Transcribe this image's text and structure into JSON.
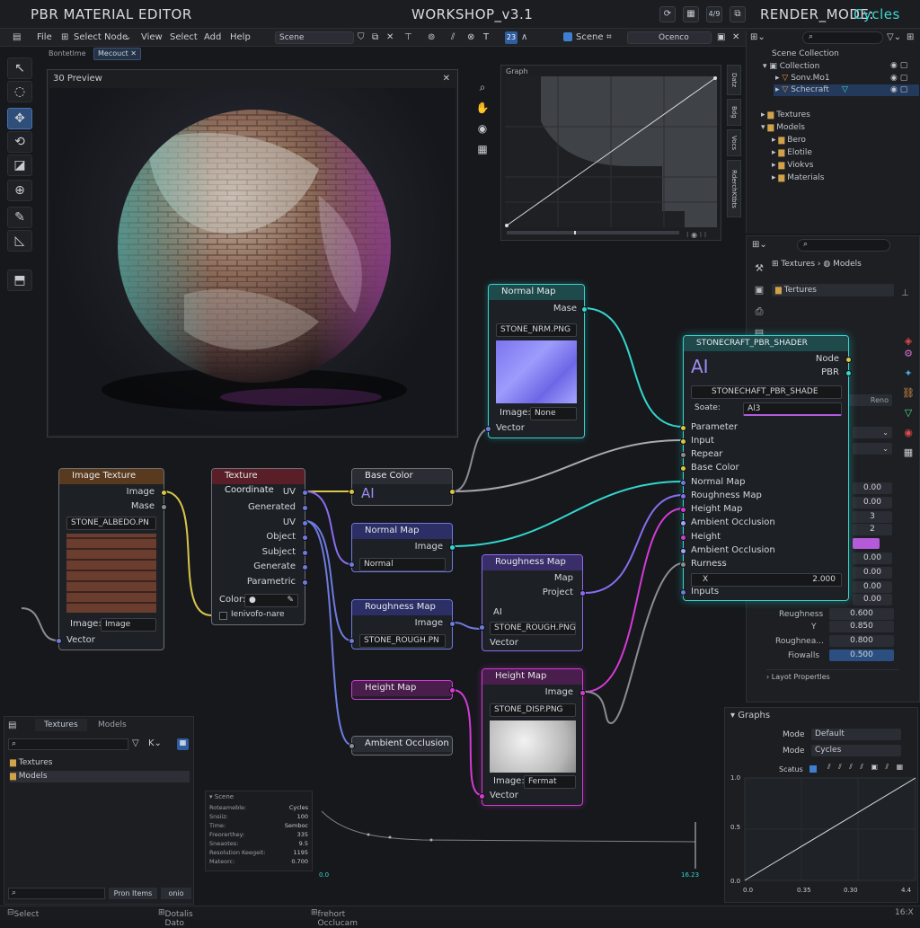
{
  "titlebar": {
    "app_title": "PBR MATERIAL EDITOR",
    "file_title": "WORKSHOP_v3.1",
    "render_mode_label": "RENDER_MODE:",
    "render_mode_value": "Cycles",
    "icons": [
      "refresh-icon",
      "grid-icon",
      "4/9",
      "copy-icon"
    ]
  },
  "menubar": {
    "items": [
      "File",
      "Select Node",
      "View",
      "Select",
      "Add",
      "Help"
    ],
    "scene_dropdown": "Scene",
    "tool_23": "23",
    "scene_label": "Scene",
    "scene_name": "Ocenco"
  },
  "tabs": {
    "first": "Bontetlme",
    "second": "Mecouct"
  },
  "preview": {
    "title": "30 Preview"
  },
  "graph": {
    "title": "Graph",
    "side_tabs": [
      "Datz",
      "Bdg",
      "Vocs",
      "RderchKtbts"
    ]
  },
  "outliner": {
    "items": [
      "Scene Collection",
      "Collection",
      "Sonv.Mo1",
      "Schecraft",
      "Textures",
      "Models",
      "Bero",
      "Elotile",
      "Viokvs",
      "Materials"
    ]
  },
  "props": {
    "breadcrumb_a": "Textures",
    "breadcrumb_b": "Models",
    "textures_field": "Tertures",
    "reno": "Reno",
    "values": [
      "0.00",
      "0.00",
      "3",
      "2",
      "0.00",
      "0.00",
      "0.00",
      "0.00"
    ],
    "roughness_label": "Reughness",
    "roughness_val": "0.600",
    "y_label": "Y",
    "y_val": "0.850",
    "roughnea_label": "Roughnea...",
    "roughnea_val": "0.800",
    "fiowalls_label": "Fiowalls",
    "fiowalls_val": "0.500",
    "layout_props": "Layot Propertles"
  },
  "nodes": {
    "normal_map_top": {
      "title": "Normal Map",
      "out": "Mase",
      "file": "STONE_NRM.PNG",
      "image_label": "Image:",
      "image_val": "None",
      "vector": "Vector"
    },
    "shader": {
      "title": "STONECRAFT_PBR_SHADER",
      "ai": "AI",
      "node": "Node",
      "pbr": "PBR",
      "name_field": "STONECHAFT_PBR_SHADE",
      "soate_label": "Soate:",
      "soate_val": "Al3",
      "inputs": [
        "Parameter",
        "Input",
        "Repear",
        "Base Color",
        "Normal Map",
        "Roughness Map",
        "Height Map",
        "Ambient Occlusion",
        "Height",
        "Ambient Occlusion",
        "Rurness",
        "X",
        "Inputs"
      ],
      "x_val": "2.000"
    },
    "image_texture": {
      "title": "Image Texture",
      "out1": "Image",
      "out2": "Mase",
      "file": "STONE_ALBEDO.PN",
      "image_label": "Image:",
      "image_val": "Image",
      "vector": "Vector"
    },
    "tex_coord": {
      "title": "Texture Coordinate",
      "rows": [
        "UV",
        "Generated",
        "UV",
        "Object",
        "Subject",
        "Generate",
        "Parametric"
      ],
      "color_label": "Color:",
      "check_label": "Ienivofo-nare"
    },
    "base_color": {
      "title": "Base Color",
      "ai": "AI"
    },
    "normal_map": {
      "title": "Normal Map",
      "out": "Image",
      "select": "Normal"
    },
    "roughness_map_l": {
      "title": "Roughness Map",
      "out": "Image",
      "file": "STONE_ROUGH.PN"
    },
    "roughness_map_r": {
      "title": "Roughness Map",
      "out1": "Map",
      "out2": "Project",
      "ai": "AI",
      "file": "STONE_ROUGH.PNG",
      "vector": "Vector"
    },
    "height_map_l": {
      "title": "Height Map"
    },
    "ao": {
      "title": "Ambient Occlusion"
    },
    "height_map_r": {
      "title": "Height Map",
      "out": "Image",
      "file": "STONE_DISP.PNG",
      "image_label": "Image:",
      "image_val": "Fermat",
      "vector": "Vector"
    }
  },
  "browser": {
    "tabs": [
      "Textures",
      "Models"
    ],
    "folders": [
      "Textures",
      "Models"
    ],
    "button": "Pron Items",
    "extra": "onio"
  },
  "stats": {
    "title": "Scene",
    "rows": [
      [
        "Roteameble:",
        "Cycles"
      ],
      [
        "Snsiiz:",
        "100"
      ],
      [
        "Time:",
        "Semboc"
      ],
      [
        "Freorerthey:",
        "335"
      ],
      [
        "Sneaotes:",
        "9.5"
      ],
      [
        "Resolution Keegeit:",
        "1195"
      ],
      [
        "Mateorc:",
        "0.700"
      ]
    ],
    "x0": "0.0",
    "x1": "16.23"
  },
  "graphs_panel": {
    "title": "Graphs",
    "mode_label": "Mode",
    "mode1": "Default",
    "mode2": "Cycles",
    "status_label": "Scatus",
    "y_ticks": [
      "1.0",
      "0.5",
      "0.0"
    ],
    "x_ticks": [
      "0.0",
      "0.35",
      "0.30",
      "4.4"
    ]
  },
  "statusbar": {
    "a": "Select",
    "b": "Dotalis Dato",
    "c": "frehort Occlucam",
    "d": "16:X"
  },
  "colors": {
    "accent_cyan": "#34d6d0",
    "accent_magenta": "#d43ad6",
    "accent_purple": "#8a6cf0",
    "accent_yellow": "#d8c64a"
  }
}
